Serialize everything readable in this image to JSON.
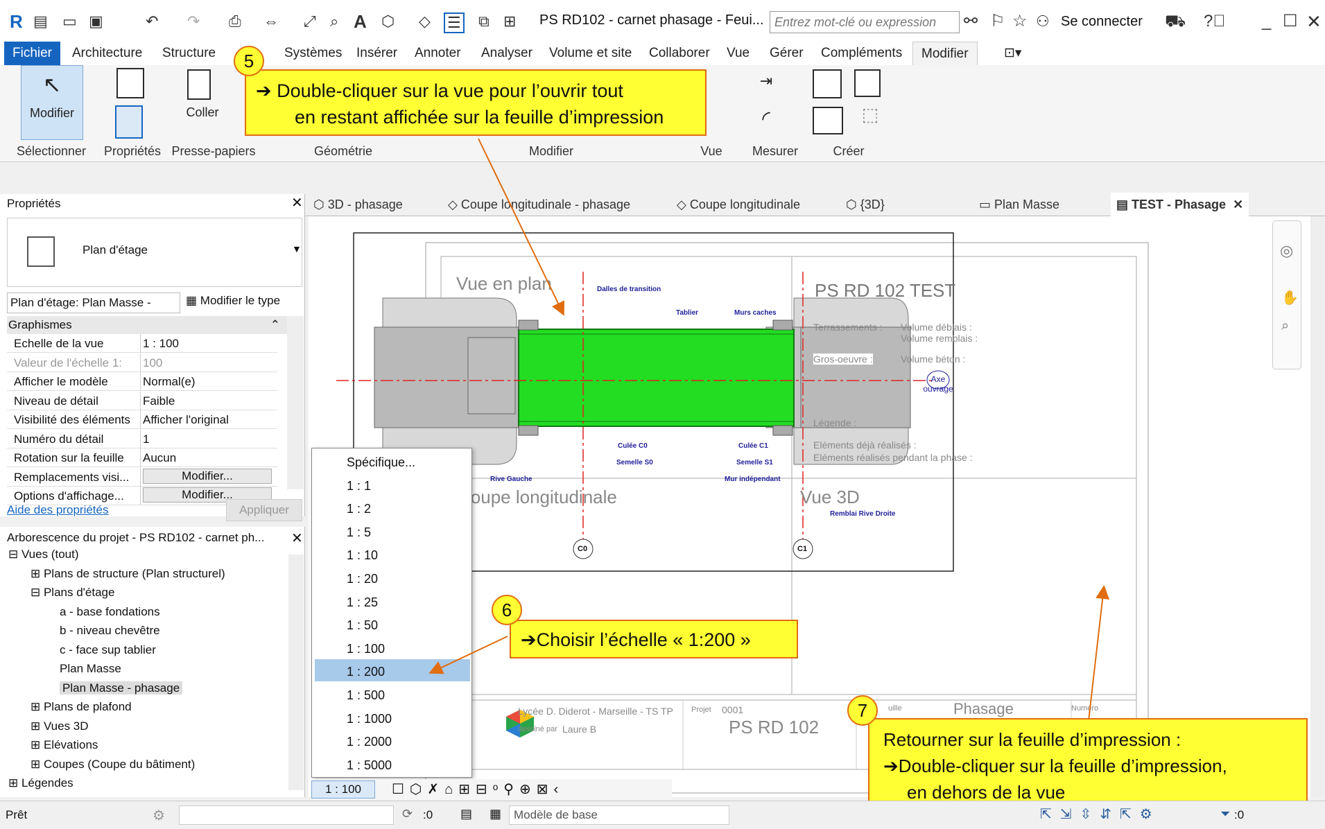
{
  "app": {
    "title": "PS RD102 - carnet phasage - Feui...",
    "search_placeholder": "Entrez mot-clé ou expression",
    "login": "Se connecter"
  },
  "ribbon_tabs": [
    "Fichier",
    "Architecture",
    "Structure",
    "Systèmes",
    "Insérer",
    "Annoter",
    "Analyser",
    "Volume et site",
    "Collaborer",
    "Vue",
    "Gérer",
    "Compléments",
    "Modifier"
  ],
  "ribbon": {
    "modify_label": "Modifier",
    "paste_label": "Coller",
    "panels": [
      "Sélectionner",
      "Propriétés",
      "Presse-papiers",
      "Géométrie",
      "Modifier",
      "Vue",
      "Mesurer",
      "Créer"
    ]
  },
  "properties": {
    "header": "Propriétés",
    "type_name": "Plan d'étage",
    "selector": "Plan d'étage: Plan Masse -",
    "edit_type": "Modifier le type",
    "group": "Graphismes",
    "rows": [
      {
        "k": "Echelle de la vue",
        "v": "1 : 100"
      },
      {
        "k": "Valeur de l'échelle   1:",
        "v": "100"
      },
      {
        "k": "Afficher le modèle",
        "v": "Normal(e)"
      },
      {
        "k": "Niveau de détail",
        "v": "Faible"
      },
      {
        "k": "Visibilité des éléments",
        "v": "Afficher l'original"
      },
      {
        "k": "Numéro du détail",
        "v": "1"
      },
      {
        "k": "Rotation sur la feuille",
        "v": "Aucun"
      },
      {
        "k": "Remplacements visi...",
        "v": "Modifier..."
      },
      {
        "k": "Options d'affichage...",
        "v": "Modifier..."
      }
    ],
    "help": "Aide des propriétés",
    "apply": "Appliquer"
  },
  "browser": {
    "header": "Arborescence du projet - PS RD102 - carnet ph...",
    "items": [
      {
        "label": "Vues (tout)",
        "level": 0
      },
      {
        "label": "Plans de structure (Plan structurel)",
        "level": 1
      },
      {
        "label": "Plans d'étage",
        "level": 1
      },
      {
        "label": "a - base fondations",
        "level": 2
      },
      {
        "label": "b - niveau chevêtre",
        "level": 2
      },
      {
        "label": "c - face sup tablier",
        "level": 2
      },
      {
        "label": "Plan Masse",
        "level": 2
      },
      {
        "label": "Plan Masse - phasage",
        "level": 2
      },
      {
        "label": "Plans de plafond",
        "level": 1
      },
      {
        "label": "Vues 3D",
        "level": 1
      },
      {
        "label": "Elévations",
        "level": 1
      },
      {
        "label": "Coupes (Coupe du bâtiment)",
        "level": 1
      },
      {
        "label": "Légendes",
        "level": 0
      }
    ]
  },
  "view_tabs": [
    "3D - phasage",
    "Coupe longitudinale - phasage",
    "Coupe longitudinale",
    "{3D}",
    "Plan Masse",
    "TEST - Phasage"
  ],
  "sheet": {
    "vue_plan": "Vue en plan",
    "title": "PS RD 102   TEST",
    "coupe": "Coupe longitudinale",
    "vue3d": "Vue 3D",
    "labels_blue": [
      "Dalles de transition",
      "Tablier",
      "Murs caches",
      "Culée C0",
      "Semelle S0",
      "Culée C1",
      "Semelle S1",
      "Rive Gauche",
      "Mur indépendant",
      "Remblai Rive Droite"
    ],
    "info_left": [
      "Terrassements :",
      "Gros-oeuvre :",
      "Légende :",
      "Eléments déjà réalisés :",
      "Eléments réalisés pendant la phase :"
    ],
    "info_right": [
      "Volume déblais :",
      "Volume remblais :",
      "Volume béton :"
    ],
    "axe": "Axe ouvrage",
    "c0": "C0",
    "c1": "C1",
    "tb_school": "Lycée D. Diderot - Marseille - TS TP",
    "tb_drawn": "dessiné par",
    "tb_author": "Laure B",
    "tb_proj_label": "Projet",
    "tb_proj_num": "0001",
    "tb_name": "PS RD 102",
    "tb_phase": "Phasage",
    "tb_num_label": "Numéro",
    "tb_feuille": "uille"
  },
  "scale_menu": [
    "Spécifique...",
    "1 : 1",
    "1 : 2",
    "1 : 5",
    "1 : 10",
    "1 : 20",
    "1 : 25",
    "1 : 50",
    "1 : 100",
    "1 : 200",
    "1 : 500",
    "1 : 1000",
    "1 : 2000",
    "1 : 5000"
  ],
  "scale_selected": "1 : 200",
  "callouts": {
    "n5": "5",
    "c5_line1": "Double-cliquer sur la vue pour l’ouvrir tout",
    "c5_line2": "en restant affichée sur la feuille d’impression",
    "n6": "6",
    "c6": "Choisir l’échelle « 1:200 »",
    "n7": "7",
    "c7_line1": "Retourner sur la feuille d’impression :",
    "c7_line2": "Double-cliquer sur la feuille d’impression,",
    "c7_line3": "en dehors de la vue"
  },
  "status": {
    "ready": "Prêt",
    "view_scale": "1 : 100",
    "zero": ":0",
    "model": "Modèle de base",
    "filter": ":0"
  },
  "colors": {
    "accent": "#1565c0",
    "callout": "#ffff33",
    "callout_border": "#e06d10",
    "deck": "#22dd22"
  }
}
